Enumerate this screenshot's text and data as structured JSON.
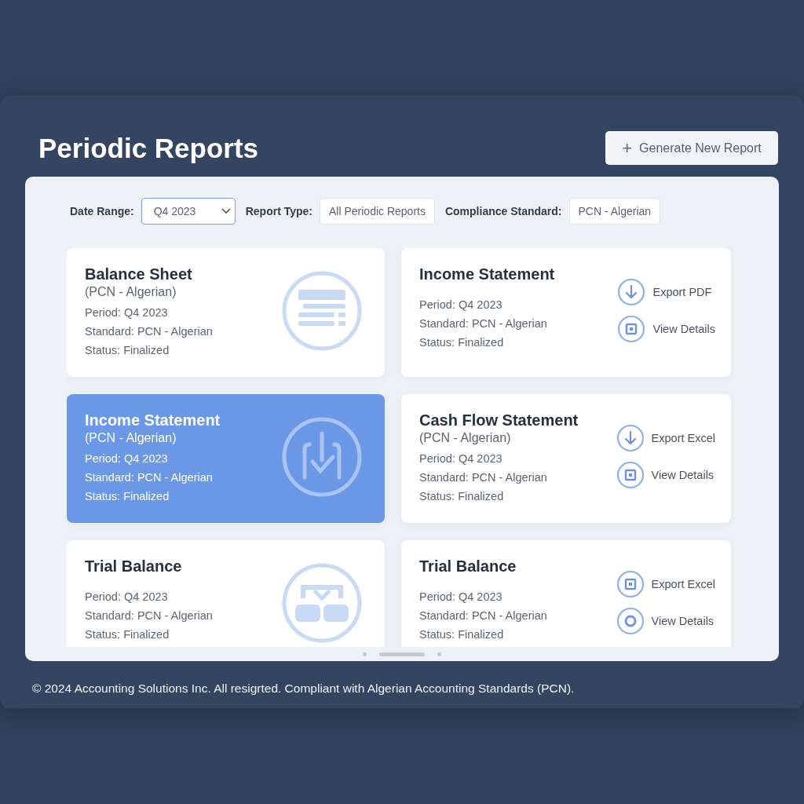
{
  "page": {
    "title": "Periodic Reports",
    "action_button": {
      "icon": "+",
      "label": "Generate New Report"
    }
  },
  "filters": [
    {
      "label": "Date Range:",
      "value": "Q4 2023",
      "kind": "dropdown",
      "focused": true
    },
    {
      "label": "Report Type:",
      "value": "All Periodic Reports",
      "kind": "field",
      "focused": false
    },
    {
      "label": "Compliance Standard:",
      "value": "PCN - Algerian",
      "kind": "field",
      "focused": false
    }
  ],
  "cards": [
    {
      "kind": "icon",
      "selected": false,
      "title": "Balance Sheet",
      "subtitle": "(PCN - Algerian)",
      "lines": [
        "Period: Q4 2023",
        "Standard: PCN - Algerian",
        "Status: Finalized"
      ]
    },
    {
      "kind": "actions",
      "selected": false,
      "title": "Income Statement",
      "lines": [
        "Period: Q4 2023",
        "Standard: PCN - Algerian",
        "Status: Finalized"
      ],
      "actions": [
        {
          "label": "Export PDF"
        },
        {
          "label": "View Details"
        }
      ]
    },
    {
      "kind": "icon",
      "selected": true,
      "title": "Income Statement",
      "subtitle": "(PCN - Algerian)",
      "lines": [
        "Period: Q4 2023",
        "Standard: PCN - Algerian",
        "Status: Finalized"
      ]
    },
    {
      "kind": "actions",
      "selected": false,
      "title": "Cash Flow Statement",
      "subtitle": "(PCN - Algerian)",
      "lines": [
        "Period: Q4 2023",
        "Standard: PCN - Algerian",
        "Status: Finalized"
      ],
      "actions": [
        {
          "label": "Export Excel"
        },
        {
          "label": "View Details"
        }
      ]
    },
    {
      "kind": "icon",
      "selected": false,
      "title": "Trial Balance",
      "lines": [
        "Period: Q4 2023",
        "Standard: PCN - Algerian",
        "Status: Finalized"
      ]
    },
    {
      "kind": "actions",
      "selected": false,
      "title": "Trial Balance",
      "lines": [
        "Period: Q4 2023",
        "Standard: PCN - Algerian",
        "Status: Finalized"
      ],
      "actions": [
        {
          "label": "Export Excel"
        },
        {
          "label": "View Details"
        }
      ]
    }
  ],
  "pager": [
    {
      "selected": false
    },
    {
      "selected": true
    },
    {
      "selected": false
    }
  ],
  "footer": "© 2024 Accounting Solutions Inc. All resigrted. Compliant with Algerian Accounting Standards (PCN)."
}
